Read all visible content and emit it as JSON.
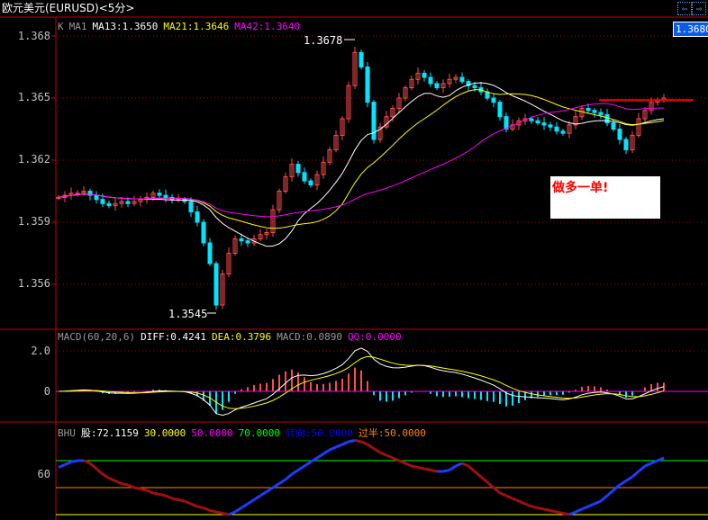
{
  "title": "欧元美元(EURUSD)<5分>",
  "nav": {
    "prev_icon": "arrow-left-icon",
    "next_icon": "arrow-right-icon",
    "prev": "⇦",
    "next": "⇨"
  },
  "price_tag": "1.3680",
  "price_header": {
    "k": "K",
    "ma1": "MA1",
    "ma13": "MA13:1.3650",
    "ma21": "MA21:1.3646",
    "ma42": "MA42:1.3640"
  },
  "macd_header": {
    "name": "MACD(60,20,6)",
    "diff": "DIFF:0.4241",
    "dea": "DEA:0.3796",
    "macd": "MACD:0.0890",
    "qq": "QQ:0.0000"
  },
  "bhu_header": {
    "name": "BHU",
    "gu": "股:72.1159",
    "v30": "30.0000",
    "v50": "50.0000",
    "v70": "70.0000",
    "zx": "转向:50.0000",
    "gb": "过半:50.0000"
  },
  "annotations": {
    "high": "1.3678",
    "low": "1.3545",
    "note": "做多一单!",
    "resistance": 1.3649
  },
  "colors": {
    "up": "#ff4b4b",
    "down": "#00e5ff",
    "ma13": "#ffffff",
    "ma21": "#ffff00",
    "ma42": "#ff00ff",
    "grid": "#a00000"
  },
  "chart_data": [
    {
      "type": "candlestick",
      "title": "欧元美元(EURUSD)<5分>",
      "yticks": [
        "1.368",
        "1.365",
        "1.362",
        "1.359",
        "1.356"
      ],
      "ylim": [
        1.3535,
        1.3695
      ],
      "close": [
        1.3602,
        1.3603,
        1.3604,
        1.3604,
        1.3605,
        1.3603,
        1.3601,
        1.3599,
        1.3598,
        1.3599,
        1.36,
        1.3599,
        1.36,
        1.3601,
        1.3602,
        1.3604,
        1.3603,
        1.3602,
        1.3601,
        1.3601,
        1.36,
        1.3595,
        1.359,
        1.358,
        1.357,
        1.355,
        1.3565,
        1.3575,
        1.3582,
        1.3581,
        1.358,
        1.3582,
        1.3584,
        1.3585,
        1.3596,
        1.3605,
        1.3612,
        1.3618,
        1.3614,
        1.361,
        1.3608,
        1.3613,
        1.3619,
        1.3625,
        1.3632,
        1.364,
        1.3656,
        1.3672,
        1.3665,
        1.3648,
        1.363,
        1.3636,
        1.3641,
        1.3645,
        1.365,
        1.3655,
        1.3659,
        1.3662,
        1.366,
        1.3657,
        1.3655,
        1.3657,
        1.3659,
        1.366,
        1.3658,
        1.3656,
        1.3655,
        1.3653,
        1.365,
        1.3648,
        1.3641,
        1.3635,
        1.3637,
        1.3639,
        1.364,
        1.3639,
        1.3638,
        1.3637,
        1.3636,
        1.3634,
        1.3633,
        1.3637,
        1.3641,
        1.3645,
        1.3644,
        1.3643,
        1.3642,
        1.3638,
        1.3635,
        1.363,
        1.3625,
        1.3632,
        1.364,
        1.3644,
        1.3648,
        1.3649,
        1.365
      ]
    },
    {
      "type": "line",
      "name": "MACD",
      "yticks": [
        "2.0",
        "0"
      ],
      "ylim": [
        -1.5,
        2.7
      ]
    },
    {
      "type": "line",
      "name": "BHU",
      "yticks": [
        "60"
      ],
      "levels": [
        30,
        50,
        70
      ],
      "ylim": [
        26,
        92
      ],
      "values": [
        65,
        67,
        69,
        70,
        70,
        68,
        64,
        60,
        57,
        55,
        53,
        52,
        50,
        49,
        48,
        46,
        45,
        44,
        42,
        41,
        40,
        38,
        36,
        35,
        33,
        32,
        31,
        30,
        32,
        35,
        38,
        41,
        44,
        47,
        50,
        53,
        56,
        60,
        63,
        66,
        69,
        72,
        75,
        78,
        80,
        82,
        84,
        85,
        84,
        82,
        79,
        76,
        74,
        72,
        70,
        68,
        66,
        65,
        64,
        63,
        62,
        62,
        63,
        66,
        68,
        66,
        62,
        58,
        54,
        50,
        46,
        44,
        42,
        40,
        38,
        36,
        35,
        34,
        33,
        32,
        31,
        30,
        32,
        34,
        36,
        38,
        40,
        44,
        48,
        52,
        55,
        58,
        62,
        66,
        68,
        70,
        72
      ]
    }
  ]
}
